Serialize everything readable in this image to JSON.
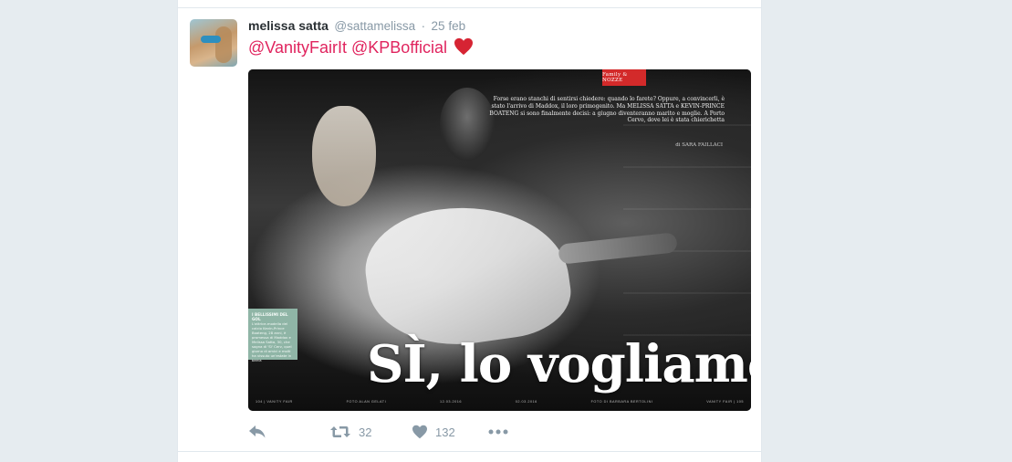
{
  "tweet": {
    "user": {
      "fullname": "melissa satta",
      "handle": "@sattamelissa",
      "separator": "·",
      "time": "25 feb"
    },
    "text": {
      "mention_1": "@VanityFairIt",
      "mention_2": "@KPBofficial"
    },
    "media": {
      "section_tag": "Family & NOZZE",
      "blurb": "Forse erano stanchi di sentirsi chiedere: quando lo farete? Oppure, a convincerli, è stato l'arrivo di Maddox, il loro primogenito. Ma MELISSA SATTA e KEVIN-PRINCE BOATENG si sono finalmente decisi: a giugno diventeranno marito e moglie. A Porto Cervo, dove lei è stata chierichetta",
      "byline": "di SARA FAILLACI",
      "sidebox_title": "I BELLISSIMI DEL GOL",
      "sidebox_text": "L'attrice-modella del calcio Kevin-Prince Boateng, 28 anni, è promessa di Maddox e Melissa Satta, 30, che sogna di 'Sì' Cerv, quel giorno di amici e molti ha vissuto un'estate in barca",
      "headline": "SÌ, lo vogliamo",
      "footer": [
        "104 | VANITY FAIR",
        "FOTO ALAN GELATI",
        "12.03.2016",
        "02.03.2016",
        "FOTO DI BARBARA BERTOLINI",
        "VANITY FAIR | 105"
      ]
    },
    "actions": {
      "retweets": "32",
      "likes": "132"
    },
    "colors": {
      "mention": "#e0245e",
      "meta": "#8899a6",
      "heart": "#e0245e"
    }
  }
}
